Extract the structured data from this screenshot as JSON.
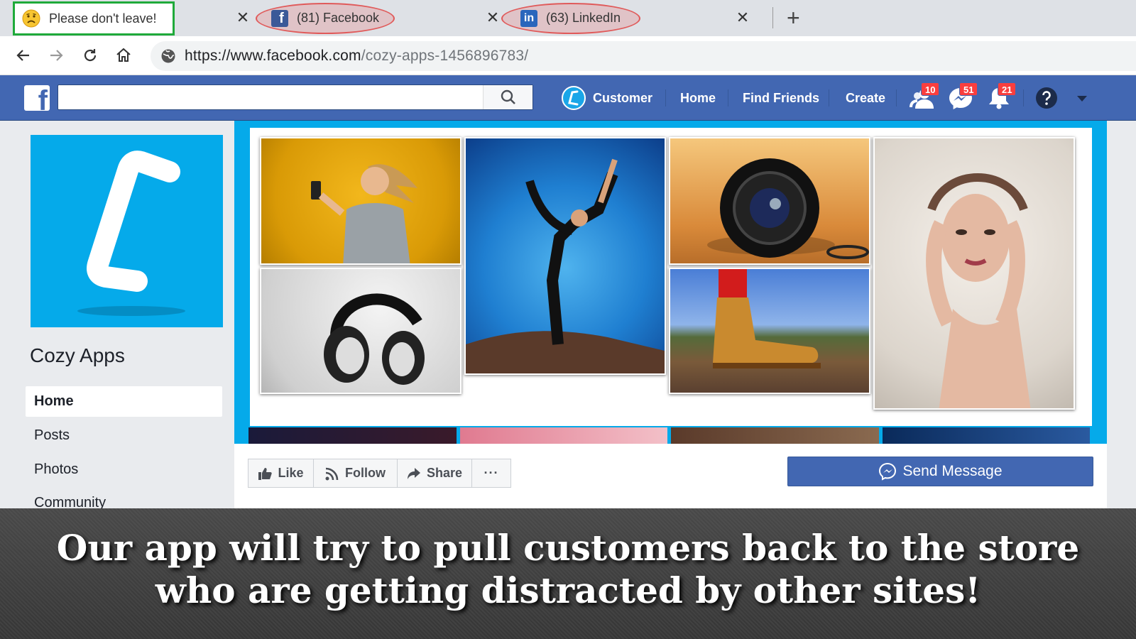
{
  "browser": {
    "tabs": [
      {
        "title": "Please don't leave!",
        "icon": "sad-face-icon",
        "active": true
      },
      {
        "title": "(81) Facebook",
        "icon": "facebook-icon",
        "active": false
      },
      {
        "title": "(63) LinkedIn",
        "icon": "linkedin-icon",
        "active": false
      }
    ],
    "url_host": "https://www.facebook.com",
    "url_path": "/cozy-apps-1456896783/"
  },
  "fb_header": {
    "logo": "f",
    "search_placeholder": "",
    "nav": {
      "customer": "Customer",
      "home": "Home",
      "find_friends": "Find Friends",
      "create": "Create"
    },
    "badges": {
      "friend_requests": "10",
      "messages": "51",
      "notifications": "21"
    }
  },
  "page": {
    "name": "Cozy Apps",
    "menu": [
      "Home",
      "Posts",
      "Photos",
      "Community"
    ]
  },
  "actions": {
    "like": "Like",
    "follow": "Follow",
    "share": "Share",
    "more": "···",
    "send_message": "Send Message"
  },
  "caption": {
    "line1": "Our app will try to pull customers back to the store",
    "line2": "who are getting distracted by other sites!"
  },
  "colors": {
    "facebook_blue": "#4267b2",
    "cover_blue": "#05aaea",
    "active_tab_border": "#1faa3a",
    "highlight_red": "#e05a5a",
    "badge_red": "#fa3e3e"
  }
}
